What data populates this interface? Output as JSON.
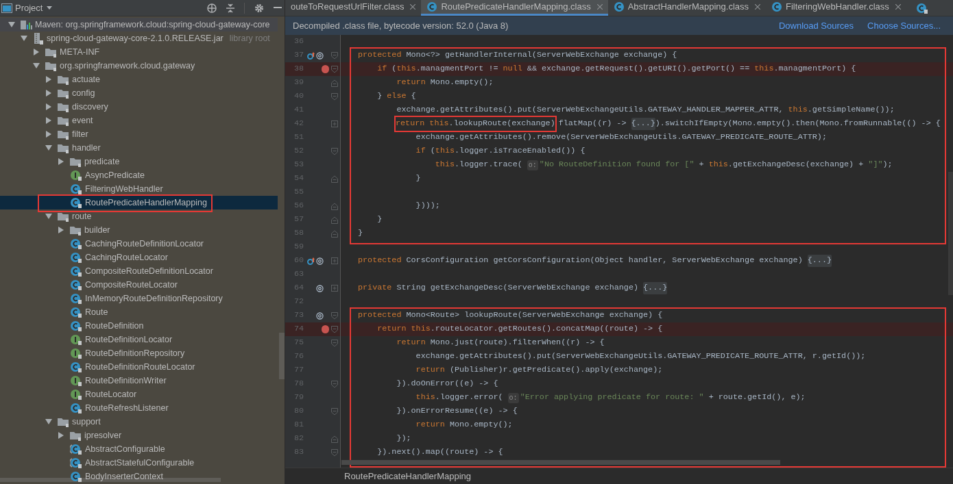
{
  "project_panel": {
    "title": "Project",
    "tree": [
      {
        "label": "Maven: org.springframework.cloud:spring-cloud-gateway-core",
        "kind": "maven",
        "expanded": true,
        "selected": false,
        "children": [
          {
            "label": "spring-cloud-gateway-core-2.1.0.RELEASE.jar",
            "note": "library root",
            "kind": "jar",
            "expanded": true,
            "selected": false,
            "children": [
              {
                "label": "META-INF",
                "kind": "folder",
                "expanded": false,
                "selected": false
              },
              {
                "label": "org.springframework.cloud.gateway",
                "kind": "folder",
                "expanded": true,
                "selected": false,
                "children": [
                  {
                    "label": "actuate",
                    "kind": "folder",
                    "expanded": false,
                    "selected": false
                  },
                  {
                    "label": "config",
                    "kind": "folder",
                    "expanded": false,
                    "selected": false
                  },
                  {
                    "label": "discovery",
                    "kind": "folder",
                    "expanded": false,
                    "selected": false
                  },
                  {
                    "label": "event",
                    "kind": "folder",
                    "expanded": false,
                    "selected": false
                  },
                  {
                    "label": "filter",
                    "kind": "folder",
                    "expanded": false,
                    "selected": false
                  },
                  {
                    "label": "handler",
                    "kind": "folder",
                    "expanded": true,
                    "selected": false,
                    "children": [
                      {
                        "label": "predicate",
                        "kind": "folder",
                        "expanded": false,
                        "selected": false
                      },
                      {
                        "label": "AsyncPredicate",
                        "kind": "interface",
                        "selected": false
                      },
                      {
                        "label": "FilteringWebHandler",
                        "kind": "class",
                        "selected": false
                      },
                      {
                        "label": "RoutePredicateHandlerMapping",
                        "kind": "class",
                        "selected": true,
                        "framed": true
                      }
                    ]
                  },
                  {
                    "label": "route",
                    "kind": "folder",
                    "expanded": true,
                    "selected": false,
                    "children": [
                      {
                        "label": "builder",
                        "kind": "folder",
                        "expanded": false,
                        "selected": false
                      },
                      {
                        "label": "CachingRouteDefinitionLocator",
                        "kind": "class",
                        "selected": false
                      },
                      {
                        "label": "CachingRouteLocator",
                        "kind": "class",
                        "selected": false
                      },
                      {
                        "label": "CompositeRouteDefinitionLocator",
                        "kind": "class",
                        "selected": false
                      },
                      {
                        "label": "CompositeRouteLocator",
                        "kind": "class",
                        "selected": false
                      },
                      {
                        "label": "InMemoryRouteDefinitionRepository",
                        "kind": "class",
                        "selected": false
                      },
                      {
                        "label": "Route",
                        "kind": "class",
                        "selected": false
                      },
                      {
                        "label": "RouteDefinition",
                        "kind": "class",
                        "selected": false
                      },
                      {
                        "label": "RouteDefinitionLocator",
                        "kind": "interface",
                        "selected": false
                      },
                      {
                        "label": "RouteDefinitionRepository",
                        "kind": "interface",
                        "selected": false
                      },
                      {
                        "label": "RouteDefinitionRouteLocator",
                        "kind": "class",
                        "selected": false
                      },
                      {
                        "label": "RouteDefinitionWriter",
                        "kind": "interface",
                        "selected": false
                      },
                      {
                        "label": "RouteLocator",
                        "kind": "interface",
                        "selected": false
                      },
                      {
                        "label": "RouteRefreshListener",
                        "kind": "class",
                        "selected": false
                      }
                    ]
                  },
                  {
                    "label": "support",
                    "kind": "folder",
                    "expanded": true,
                    "selected": false,
                    "children": [
                      {
                        "label": "ipresolver",
                        "kind": "folder",
                        "expanded": false,
                        "selected": false
                      },
                      {
                        "label": "AbstractConfigurable",
                        "kind": "abstract",
                        "selected": false
                      },
                      {
                        "label": "AbstractStatefulConfigurable",
                        "kind": "abstract",
                        "selected": false
                      },
                      {
                        "label": "BodyInserterContext",
                        "kind": "class",
                        "selected": false
                      }
                    ]
                  }
                ]
              }
            ]
          }
        ]
      }
    ]
  },
  "editor": {
    "tabs": [
      {
        "label": "outeToRequestUrlFilter.class",
        "icon": false,
        "selected": false
      },
      {
        "label": "RoutePredicateHandlerMapping.class",
        "icon": true,
        "selected": true
      },
      {
        "label": "AbstractHandlerMapping.class",
        "icon": true,
        "selected": false
      },
      {
        "label": "FilteringWebHandler.class",
        "icon": true,
        "selected": false
      }
    ],
    "banner": {
      "text": "Decompiled .class file, bytecode version: 52.0 (Java 8)",
      "links": [
        "Download Sources",
        "Choose Sources..."
      ]
    },
    "blocks": [
      {
        "framed": false,
        "lines": [
          {
            "n": "36"
          }
        ]
      },
      {
        "framed": true,
        "lines": [
          {
            "n": "37",
            "gutter": {
              "kind": "override"
            },
            "fold": {
              "kind": "open"
            },
            "segs": [
              {
                "kind": "kw",
                "text": "protected "
              },
              {
                "kind": "plain",
                "text": "Mono<?> getHandlerInternal(ServerWebExchange exchange) {"
              }
            ]
          },
          {
            "n": "38",
            "breakpoint": true,
            "fold": {
              "kind": "open"
            },
            "segs": [
              {
                "kind": "kw",
                "text": "    if "
              },
              {
                "kind": "plain",
                "text": "("
              },
              {
                "kind": "kw",
                "text": "this"
              },
              {
                "kind": "plain",
                "text": ".managmentPort != "
              },
              {
                "kind": "kw",
                "text": "null"
              },
              {
                "kind": "plain",
                "text": " && exchange.getRequest().getURI().getPort() == "
              },
              {
                "kind": "kw",
                "text": "this"
              },
              {
                "kind": "plain",
                "text": ".managmentPort) {"
              }
            ]
          },
          {
            "n": "39",
            "fold": {
              "kind": "close"
            },
            "segs": [
              {
                "kind": "kw",
                "text": "        return "
              },
              {
                "kind": "plain",
                "text": "Mono.empty();"
              }
            ]
          },
          {
            "n": "40",
            "fold": {
              "kind": "open"
            },
            "segs": [
              {
                "kind": "plain",
                "text": "    } "
              },
              {
                "kind": "kw",
                "text": "else"
              },
              {
                "kind": "plain",
                "text": " {"
              }
            ]
          },
          {
            "n": "41",
            "segs": [
              {
                "kind": "plain",
                "text": "        exchange.getAttributes().put(ServerWebExchangeUtils.GATEWAY_HANDLER_MAPPER_ATTR, "
              },
              {
                "kind": "kw",
                "text": "this"
              },
              {
                "kind": "plain",
                "text": ".getSimpleName());"
              }
            ]
          },
          {
            "n": "42",
            "fold": {
              "kind": "collapsed"
            },
            "segs": [
              {
                "kind": "framed",
                "parts": [
                  {
                    "kind": "kw",
                    "text": "return this"
                  },
                  {
                    "kind": "plain",
                    "text": ".lookupRoute(exchange)"
                  }
                ]
              },
              {
                "kind": "plain",
                "text": "flatMap((r) -> "
              },
              {
                "kind": "fold",
                "text": "{...}"
              },
              {
                "kind": "plain",
                "text": ").switchIfEmpty(Mono.empty().then(Mono.fromRunnable(() -> {"
              }
            ]
          },
          {
            "n": "51",
            "segs": [
              {
                "kind": "plain",
                "text": "            exchange.getAttributes().remove(ServerWebExchangeUtils.GATEWAY_PREDICATE_ROUTE_ATTR);"
              }
            ]
          },
          {
            "n": "52",
            "fold": {
              "kind": "open"
            },
            "segs": [
              {
                "kind": "kw",
                "text": "            if"
              },
              {
                "kind": "plain",
                "text": " ("
              },
              {
                "kind": "kw",
                "text": "this"
              },
              {
                "kind": "plain",
                "text": ".logger.isTraceEnabled()) {"
              }
            ]
          },
          {
            "n": "53",
            "segs": [
              {
                "kind": "kw",
                "text": "                this"
              },
              {
                "kind": "plain",
                "text": ".logger.trace( "
              },
              {
                "kind": "hint",
                "text": "o:"
              },
              {
                "kind": "str",
                "text": "\"No RouteDefinition found for [\""
              },
              {
                "kind": "plain",
                "text": " + "
              },
              {
                "kind": "kw",
                "text": "this"
              },
              {
                "kind": "plain",
                "text": ".getExchangeDesc(exchange) + "
              },
              {
                "kind": "str",
                "text": "\"]\""
              },
              {
                "kind": "plain",
                "text": ");"
              }
            ]
          },
          {
            "n": "54",
            "fold": {
              "kind": "close"
            },
            "segs": [
              {
                "kind": "plain",
                "text": "            }"
              }
            ]
          },
          {
            "n": "55"
          },
          {
            "n": "56",
            "fold": {
              "kind": "close"
            },
            "segs": [
              {
                "kind": "plain",
                "text": "            })));"
              }
            ]
          },
          {
            "n": "57",
            "fold": {
              "kind": "close"
            },
            "segs": [
              {
                "kind": "plain",
                "text": "    }"
              }
            ]
          },
          {
            "n": "58",
            "fold": {
              "kind": "close"
            },
            "segs": [
              {
                "kind": "plain",
                "text": "}"
              }
            ]
          }
        ]
      },
      {
        "framed": false,
        "lines": [
          {
            "n": "59"
          },
          {
            "n": "60",
            "gutter": {
              "kind": "override"
            },
            "fold": {
              "kind": "collapsed"
            },
            "segs": [
              {
                "kind": "kw",
                "text": "protected "
              },
              {
                "kind": "plain",
                "text": "CorsConfiguration getCorsConfiguration(Object handler, ServerWebExchange exchange) "
              },
              {
                "kind": "fold",
                "text": "{...}"
              }
            ]
          },
          {
            "n": "63"
          },
          {
            "n": "64",
            "gutter": {
              "kind": "at"
            },
            "fold": {
              "kind": "collapsed"
            },
            "segs": [
              {
                "kind": "kw",
                "text": "private "
              },
              {
                "kind": "plain",
                "text": "String getExchangeDesc(ServerWebExchange exchange) "
              },
              {
                "kind": "fold",
                "text": "{...}"
              }
            ]
          },
          {
            "n": "72"
          }
        ]
      },
      {
        "framed": true,
        "lines": [
          {
            "n": "73",
            "gutter": {
              "kind": "at"
            },
            "fold": {
              "kind": "open"
            },
            "segs": [
              {
                "kind": "kw",
                "text": "protected "
              },
              {
                "kind": "plain",
                "text": "Mono<Route> lookupRoute(ServerWebExchange exchange) {"
              }
            ]
          },
          {
            "n": "74",
            "breakpoint": true,
            "fold": {
              "kind": "open"
            },
            "segs": [
              {
                "kind": "kw",
                "text": "    return this"
              },
              {
                "kind": "plain",
                "text": ".routeLocator.getRoutes().concatMap((route) -> {"
              }
            ]
          },
          {
            "n": "75",
            "fold": {
              "kind": "open"
            },
            "segs": [
              {
                "kind": "kw",
                "text": "        return "
              },
              {
                "kind": "plain",
                "text": "Mono.just(route).filterWhen((r) -> {"
              }
            ]
          },
          {
            "n": "76",
            "segs": [
              {
                "kind": "plain",
                "text": "            exchange.getAttributes().put(ServerWebExchangeUtils.GATEWAY_PREDICATE_ROUTE_ATTR, r.getId());"
              }
            ]
          },
          {
            "n": "77",
            "segs": [
              {
                "kind": "kw",
                "text": "            return "
              },
              {
                "kind": "plain",
                "text": "(Publisher)r.getPredicate().apply(exchange);"
              }
            ]
          },
          {
            "n": "78",
            "fold": {
              "kind": "open"
            },
            "segs": [
              {
                "kind": "plain",
                "text": "        }).doOnError((e) -> {"
              }
            ]
          },
          {
            "n": "79",
            "segs": [
              {
                "kind": "kw",
                "text": "            this"
              },
              {
                "kind": "plain",
                "text": ".logger.error( "
              },
              {
                "kind": "hint",
                "text": "o:"
              },
              {
                "kind": "str",
                "text": "\"Error applying predicate for route: \""
              },
              {
                "kind": "plain",
                "text": " + route.getId(), e);"
              }
            ]
          },
          {
            "n": "80",
            "fold": {
              "kind": "open"
            },
            "segs": [
              {
                "kind": "plain",
                "text": "        }).onErrorResume((e) -> {"
              }
            ]
          },
          {
            "n": "81",
            "segs": [
              {
                "kind": "kw",
                "text": "            return "
              },
              {
                "kind": "plain",
                "text": "Mono.empty();"
              }
            ]
          },
          {
            "n": "82",
            "fold": {
              "kind": "close"
            },
            "segs": [
              {
                "kind": "plain",
                "text": "        });"
              }
            ]
          },
          {
            "n": "83",
            "fold": {
              "kind": "open"
            },
            "segs": [
              {
                "kind": "plain",
                "text": "    }).next().map((route) -> {"
              }
            ]
          }
        ]
      }
    ],
    "breadcrumb": "RoutePredicateHandlerMapping"
  }
}
